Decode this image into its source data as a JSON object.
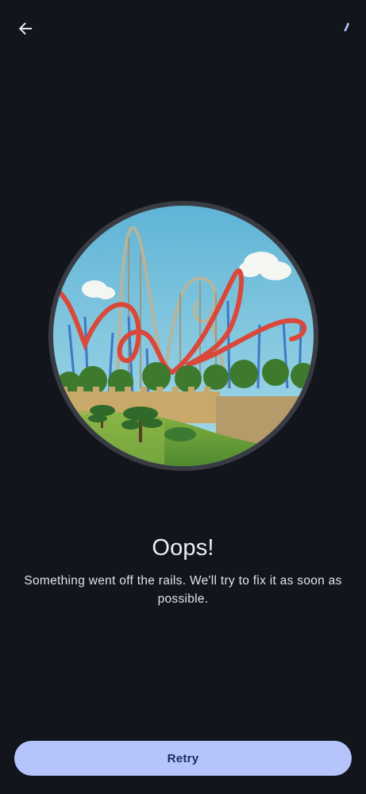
{
  "header": {
    "back_icon": "arrow-left-icon",
    "loading_icon": "loading-spinner-icon"
  },
  "illustration": {
    "subject": "roller-coaster-illustration"
  },
  "error": {
    "title": "Oops!",
    "message": "Something went off the rails. We'll try to fix it as soon as possible."
  },
  "actions": {
    "retry_label": "Retry"
  },
  "colors": {
    "background": "#13151c",
    "accent": "#b5c5fb",
    "accent_text": "#1c2a5c",
    "text": "#e7e8ee"
  }
}
